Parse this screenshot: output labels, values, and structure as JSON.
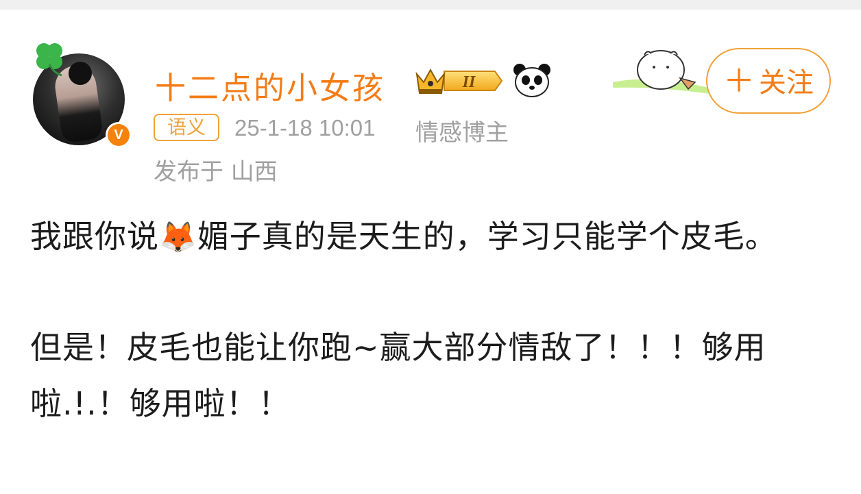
{
  "user": {
    "name": "十二点的小女孩",
    "level_badge": "II",
    "verified_badge": "V"
  },
  "meta": {
    "tag": "语义",
    "time": "25-1-18 10:01",
    "blogger_type": "情感博主",
    "location": "发布于 山西"
  },
  "follow": {
    "label": "关注",
    "icon": "plus-icon"
  },
  "post": {
    "paragraph1_before": "我跟你说",
    "paragraph1_emoji": "🦊",
    "paragraph1_after": "媚子真的是天生的，学习只能学个皮毛。",
    "paragraph2": "但是！皮毛也能让你跑~赢大部分情敌了！！！够用啦.!.！够用啦！！"
  },
  "colors": {
    "brand_orange": "#f47c17",
    "border_orange": "#f0a238",
    "meta_gray": "#a0a0a0",
    "text": "#1c1c1c"
  }
}
